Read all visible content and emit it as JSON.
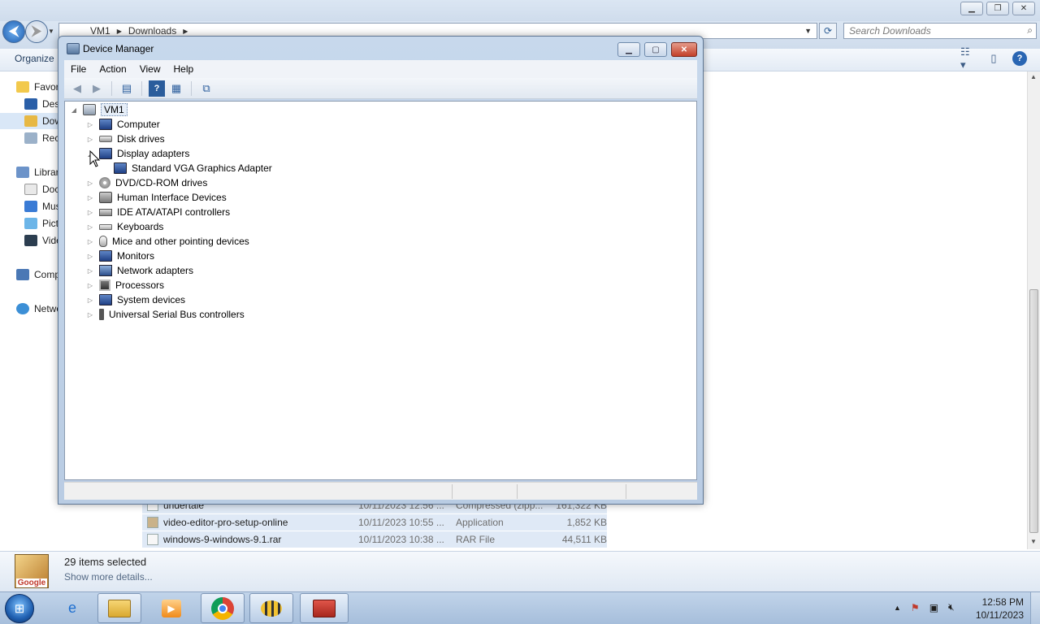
{
  "explorer": {
    "breadcrumb": [
      "VM1",
      "Downloads"
    ],
    "search_placeholder": "Search Downloads",
    "organize_label": "Organize",
    "nav_items": [
      {
        "label": "Favorites",
        "name": "nav-favorites"
      },
      {
        "label": "Desktop",
        "name": "nav-desktop"
      },
      {
        "label": "Downloads",
        "name": "nav-downloads"
      },
      {
        "label": "Recent Places",
        "name": "nav-recent-places"
      },
      {
        "label": "Libraries",
        "name": "nav-libraries"
      },
      {
        "label": "Documents",
        "name": "nav-documents"
      },
      {
        "label": "Music",
        "name": "nav-music"
      },
      {
        "label": "Pictures",
        "name": "nav-pictures"
      },
      {
        "label": "Videos",
        "name": "nav-videos"
      },
      {
        "label": "Computer",
        "name": "nav-computer"
      },
      {
        "label": "Network",
        "name": "nav-network"
      }
    ],
    "files": [
      {
        "name": "undertale",
        "date": "10/11/2023 12:56 ...",
        "type": "Compressed (zipp...",
        "size": "161,322 KB"
      },
      {
        "name": "video-editor-pro-setup-online",
        "date": "10/11/2023 10:55 ...",
        "type": "Application",
        "size": "1,852 KB"
      },
      {
        "name": "windows-9-windows-9.1.rar",
        "date": "10/11/2023 10:38 ...",
        "type": "RAR File",
        "size": "44,511 KB"
      }
    ],
    "details": {
      "count": "29 items selected",
      "more": "Show more details...",
      "thumb_label": "Google"
    }
  },
  "device_manager": {
    "title": "Device Manager",
    "menu": [
      "File",
      "Action",
      "View",
      "Help"
    ],
    "root": "VM1",
    "tree": [
      {
        "label": "Computer",
        "icon": "ic-monitor",
        "expanded": false
      },
      {
        "label": "Disk drives",
        "icon": "ic-disk",
        "expanded": false
      },
      {
        "label": "Display adapters",
        "icon": "ic-monitor",
        "expanded": true
      },
      {
        "label": "Standard VGA Graphics Adapter",
        "icon": "ic-monitor",
        "child": true
      },
      {
        "label": "DVD/CD-ROM drives",
        "icon": "ic-dvd",
        "expanded": false
      },
      {
        "label": "Human Interface Devices",
        "icon": "ic-hid",
        "expanded": false
      },
      {
        "label": "IDE ATA/ATAPI controllers",
        "icon": "ic-ide",
        "expanded": false
      },
      {
        "label": "Keyboards",
        "icon": "ic-kbd",
        "expanded": false
      },
      {
        "label": "Mice and other pointing devices",
        "icon": "ic-mouse",
        "expanded": false
      },
      {
        "label": "Monitors",
        "icon": "ic-monitor",
        "expanded": false
      },
      {
        "label": "Network adapters",
        "icon": "ic-net",
        "expanded": false
      },
      {
        "label": "Processors",
        "icon": "ic-cpu",
        "expanded": false
      },
      {
        "label": "System devices",
        "icon": "ic-monitor",
        "expanded": false
      },
      {
        "label": "Universal Serial Bus controllers",
        "icon": "ic-usb",
        "expanded": false
      }
    ]
  },
  "taskbar": {
    "time": "12:58 PM",
    "date": "10/11/2023",
    "apps": [
      "internet-explorer-icon",
      "file-explorer-icon",
      "media-player-icon",
      "chrome-icon",
      "bee-app-icon",
      "toolbox-app-icon"
    ]
  }
}
